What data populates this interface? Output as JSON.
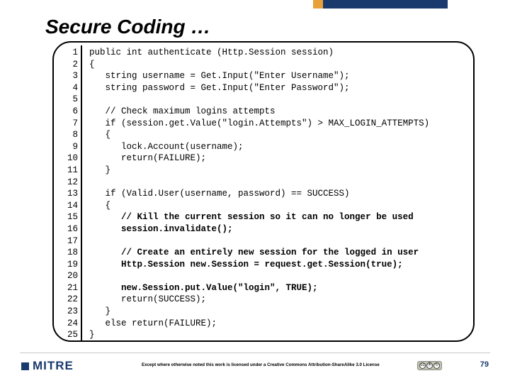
{
  "title": "Secure Coding …",
  "line_numbers": [
    "1",
    "2",
    "3",
    "4",
    "5",
    "6",
    "7",
    "8",
    "9",
    "10",
    "11",
    "12",
    "13",
    "14",
    "15",
    "16",
    "17",
    "18",
    "19",
    "20",
    "21",
    "22",
    "23",
    "24",
    "25"
  ],
  "code": [
    {
      "bold": false,
      "text": "public int authenticate (Http.Session session)"
    },
    {
      "bold": false,
      "text": "{"
    },
    {
      "bold": false,
      "text": "   string username = Get.Input(\"Enter Username\");"
    },
    {
      "bold": false,
      "text": "   string password = Get.Input(\"Enter Password\");"
    },
    {
      "bold": false,
      "text": ""
    },
    {
      "bold": false,
      "text": "   // Check maximum logins attempts"
    },
    {
      "bold": false,
      "text": "   if (session.get.Value(\"login.Attempts\") > MAX_LOGIN_ATTEMPTS)"
    },
    {
      "bold": false,
      "text": "   {"
    },
    {
      "bold": false,
      "text": "      lock.Account(username);"
    },
    {
      "bold": false,
      "text": "      return(FAILURE);"
    },
    {
      "bold": false,
      "text": "   }"
    },
    {
      "bold": false,
      "text": ""
    },
    {
      "bold": false,
      "text": "   if (Valid.User(username, password) == SUCCESS)"
    },
    {
      "bold": false,
      "text": "   {"
    },
    {
      "bold": true,
      "text": "      // Kill the current session so it can no longer be used"
    },
    {
      "bold": true,
      "text": "      session.invalidate();"
    },
    {
      "bold": false,
      "text": ""
    },
    {
      "bold": true,
      "text": "      // Create an entirely new session for the logged in user"
    },
    {
      "bold": true,
      "text": "      Http.Session new.Session = request.get.Session(true);"
    },
    {
      "bold": false,
      "text": ""
    },
    {
      "bold": true,
      "text": "      new.Session.put.Value(\"login\", TRUE);"
    },
    {
      "bold": false,
      "text": "      return(SUCCESS);"
    },
    {
      "bold": false,
      "text": "   }"
    },
    {
      "bold": false,
      "text": "   else return(FAILURE);"
    },
    {
      "bold": false,
      "text": "}"
    }
  ],
  "logo_text": "MITRE",
  "license_text": "Except where otherwise noted this work is licensed under a Creative Commons Attribution-ShareAlike 3.0 License",
  "cc_labels": [
    "cc",
    "⦿",
    "↻"
  ],
  "page_number": "79"
}
